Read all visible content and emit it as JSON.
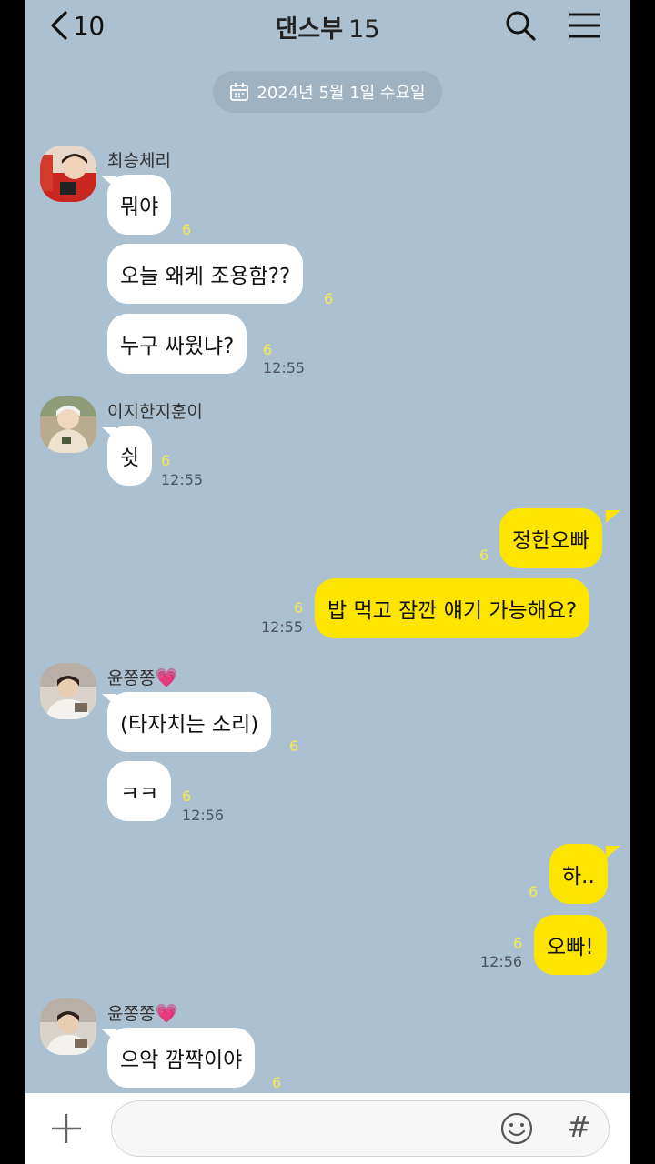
{
  "header": {
    "back_count": "10",
    "title": "댄스부",
    "member_count": "15"
  },
  "date_divider": "2024년 5월 1일 수요일",
  "messages": [
    {
      "sender": "최승체리",
      "text": "뭐야",
      "unread": "6"
    },
    {
      "text": "오늘 왜케 조용함??",
      "unread": "6"
    },
    {
      "text": "누구 싸웠냐?",
      "unread": "6",
      "time": "12:55"
    },
    {
      "sender": "이지한지훈이",
      "text": "쉿",
      "unread": "6",
      "time": "12:55"
    },
    {
      "text": "정한오빠",
      "unread": "6"
    },
    {
      "text": "밥 먹고 잠깐 얘기 가능해요?",
      "unread": "6",
      "time": "12:55"
    },
    {
      "sender": "윤쫑쫑",
      "sender_emoji": "💗",
      "text": "(타자치는 소리)",
      "unread": "6"
    },
    {
      "text": "ㅋㅋ",
      "unread": "6",
      "time": "12:56"
    },
    {
      "text": "하..",
      "unread": "6"
    },
    {
      "text": "오빠!",
      "unread": "6",
      "time": "12:56"
    },
    {
      "sender": "윤쫑쫑",
      "sender_emoji": "💗",
      "text": "으악 깜짝이야",
      "unread": "6"
    }
  ],
  "input": {
    "value": "",
    "placeholder": ""
  },
  "colors": {
    "background": "#abc1d1",
    "my_bubble": "#fee500",
    "other_bubble": "#ffffff",
    "unread": "#f6e84e"
  },
  "icons": [
    "chevron-left-icon",
    "search-icon",
    "menu-icon",
    "calendar-icon",
    "plus-icon",
    "emoji-icon",
    "hash-icon"
  ]
}
